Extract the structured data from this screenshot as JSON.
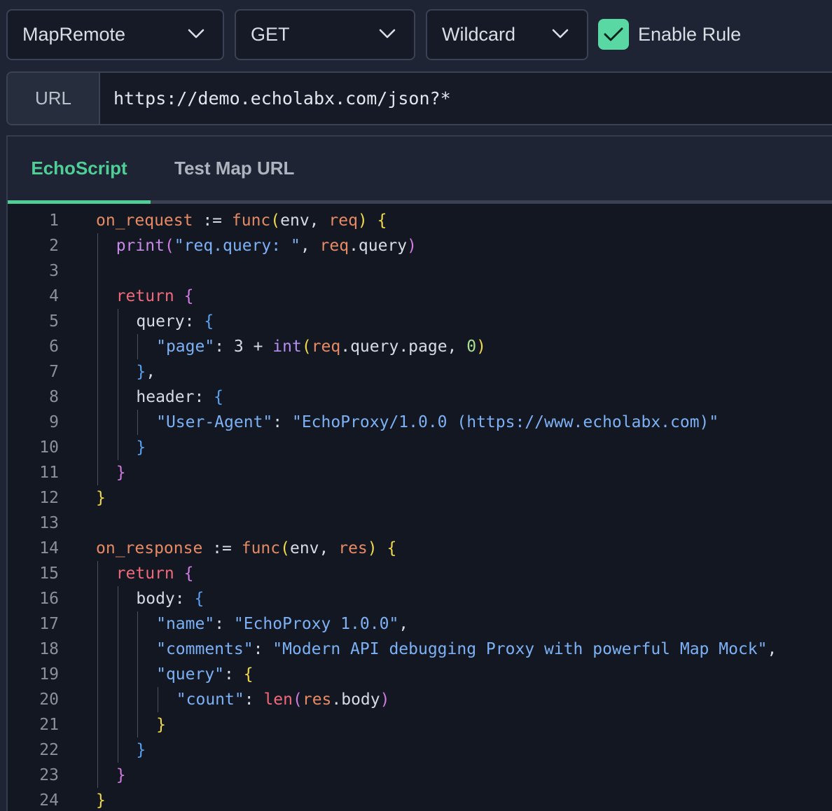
{
  "toolbar": {
    "rule_type": "MapRemote",
    "method": "GET",
    "match_mode": "Wildcard",
    "enable_rule_label": "Enable Rule",
    "enable_rule_checked": true
  },
  "url": {
    "label": "URL",
    "value": "https://demo.echolabx.com/json?*"
  },
  "tabs": [
    {
      "label": "EchoScript",
      "active": true
    },
    {
      "label": "Test Map URL",
      "active": false
    }
  ],
  "colors": {
    "accent": "#4fcf95",
    "checkbox": "#59d8a3"
  },
  "editor": {
    "lines": [
      {
        "n": "1",
        "tokens": [
          [
            "on_request",
            "ident"
          ],
          [
            " := ",
            "op"
          ],
          [
            "func",
            "func"
          ],
          [
            "(",
            "b1"
          ],
          [
            "env, ",
            "op"
          ],
          [
            "req",
            "var"
          ],
          [
            ")",
            "b1"
          ],
          [
            " ",
            "op"
          ],
          [
            "{",
            "b1"
          ]
        ]
      },
      {
        "n": "2",
        "tokens": [
          [
            "print",
            "fn"
          ],
          [
            "(",
            "b2"
          ],
          [
            "\"req.query: \"",
            "str"
          ],
          [
            ", ",
            "op"
          ],
          [
            "req",
            "var"
          ],
          [
            ".query",
            "op"
          ],
          [
            ")",
            "b2"
          ]
        ]
      },
      {
        "n": "3",
        "tokens": []
      },
      {
        "n": "4",
        "tokens": [
          [
            "return",
            "kw"
          ],
          [
            " ",
            "op"
          ],
          [
            "{",
            "b2"
          ]
        ]
      },
      {
        "n": "5",
        "tokens": [
          [
            "query: ",
            "key"
          ],
          [
            "{",
            "b3"
          ]
        ]
      },
      {
        "n": "6",
        "tokens": [
          [
            "\"page\"",
            "str"
          ],
          [
            ": 3 + ",
            "num"
          ],
          [
            "int",
            "builtin"
          ],
          [
            "(",
            "b1"
          ],
          [
            "req",
            "var"
          ],
          [
            ".query.page, ",
            "op"
          ],
          [
            "0",
            "zero"
          ],
          [
            ")",
            "b1"
          ]
        ]
      },
      {
        "n": "7",
        "tokens": [
          [
            "}",
            "b3"
          ],
          [
            ",",
            "op"
          ]
        ]
      },
      {
        "n": "8",
        "tokens": [
          [
            "header: ",
            "key"
          ],
          [
            "{",
            "b3"
          ]
        ]
      },
      {
        "n": "9",
        "tokens": [
          [
            "\"User-Agent\"",
            "str"
          ],
          [
            ": ",
            "op"
          ],
          [
            "\"EchoProxy/1.0.0 (https://www.echolabx.com)\"",
            "str"
          ]
        ]
      },
      {
        "n": "10",
        "tokens": [
          [
            "}",
            "b3"
          ]
        ]
      },
      {
        "n": "11",
        "tokens": [
          [
            "}",
            "b2"
          ]
        ]
      },
      {
        "n": "12",
        "tokens": [
          [
            "}",
            "b1"
          ]
        ]
      },
      {
        "n": "13",
        "tokens": []
      },
      {
        "n": "14",
        "tokens": [
          [
            "on_response",
            "ident"
          ],
          [
            " := ",
            "op"
          ],
          [
            "func",
            "func"
          ],
          [
            "(",
            "b1"
          ],
          [
            "env, ",
            "op"
          ],
          [
            "res",
            "var"
          ],
          [
            ")",
            "b1"
          ],
          [
            " ",
            "op"
          ],
          [
            "{",
            "b1"
          ]
        ]
      },
      {
        "n": "15",
        "tokens": [
          [
            "return",
            "kw"
          ],
          [
            " ",
            "op"
          ],
          [
            "{",
            "b2"
          ]
        ]
      },
      {
        "n": "16",
        "tokens": [
          [
            "body: ",
            "key"
          ],
          [
            "{",
            "b3"
          ]
        ]
      },
      {
        "n": "17",
        "tokens": [
          [
            "\"name\"",
            "str"
          ],
          [
            ": ",
            "op"
          ],
          [
            "\"EchoProxy 1.0.0\"",
            "str"
          ],
          [
            ",",
            "op"
          ]
        ]
      },
      {
        "n": "18",
        "tokens": [
          [
            "\"comments\"",
            "str"
          ],
          [
            ": ",
            "op"
          ],
          [
            "\"Modern API debugging Proxy with powerful Map Mock\"",
            "str"
          ],
          [
            ",",
            "op"
          ]
        ]
      },
      {
        "n": "19",
        "tokens": [
          [
            "\"query\"",
            "str"
          ],
          [
            ": ",
            "op"
          ],
          [
            "{",
            "b1"
          ]
        ]
      },
      {
        "n": "20",
        "tokens": [
          [
            "\"count\"",
            "str"
          ],
          [
            ": ",
            "op"
          ],
          [
            "len",
            "len"
          ],
          [
            "(",
            "b2"
          ],
          [
            "res",
            "var"
          ],
          [
            ".body",
            "op"
          ],
          [
            ")",
            "b2"
          ]
        ]
      },
      {
        "n": "21",
        "tokens": [
          [
            "}",
            "b1"
          ]
        ]
      },
      {
        "n": "22",
        "tokens": [
          [
            "}",
            "b3"
          ]
        ]
      },
      {
        "n": "23",
        "tokens": [
          [
            "}",
            "b2"
          ]
        ]
      },
      {
        "n": "24",
        "tokens": [
          [
            "}",
            "b1"
          ]
        ]
      }
    ]
  }
}
